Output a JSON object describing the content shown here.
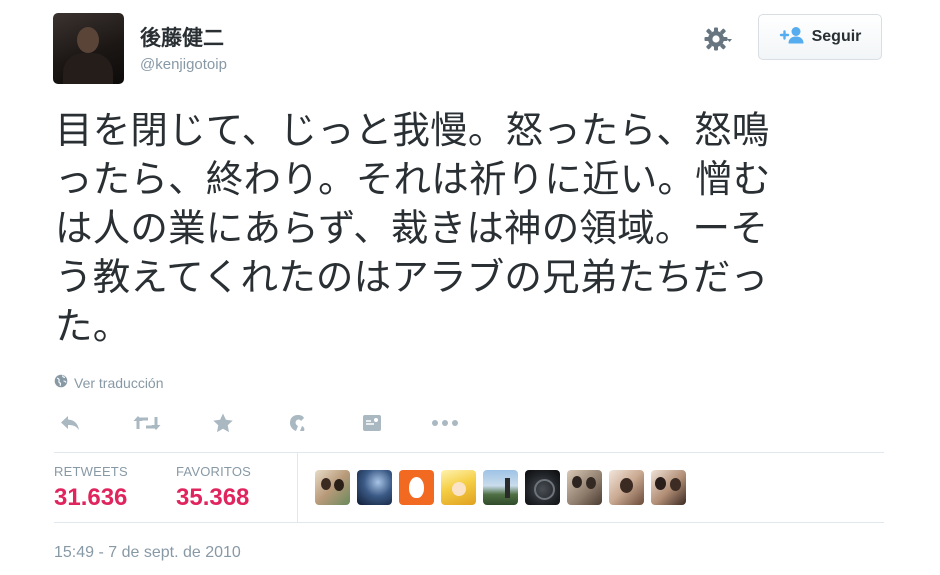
{
  "user": {
    "name": "後藤健二",
    "handle": "@kenjigotoip"
  },
  "follow_button": {
    "label": "Seguir"
  },
  "tweet": {
    "text": "目を閉じて、じっと我慢。怒ったら、怒鳴\nったら、終わり。それは祈りに近い。憎む\nは人の業にあらず、裁きは神の領域。ーそ\nう教えてくれたのはアラブの兄弟たちだっ\nた。",
    "translate_label": "Ver traducción",
    "timestamp": "15:49 - 7 de sept. de 2010"
  },
  "stats": {
    "retweets_label": "RETWEETS",
    "retweets_value": "31.636",
    "favorites_label": "FAVORITOS",
    "favorites_value": "35.368"
  },
  "icons": {
    "settings": "gear-icon",
    "follow": "add-user-icon",
    "translate": "globe-icon",
    "actions": [
      "reply-icon",
      "retweet-icon",
      "favorite-icon",
      "vine-icon",
      "photo-icon",
      "more-icon"
    ]
  },
  "colors": {
    "accent": "#55acee",
    "count": "#e0245e",
    "muted": "#8899a6",
    "text": "#292f33"
  },
  "favoriters": [
    {
      "avatar": "user-avatar-1"
    },
    {
      "avatar": "user-avatar-2"
    },
    {
      "avatar": "user-avatar-3"
    },
    {
      "avatar": "user-avatar-4"
    },
    {
      "avatar": "user-avatar-5"
    },
    {
      "avatar": "user-avatar-6"
    },
    {
      "avatar": "user-avatar-7"
    },
    {
      "avatar": "user-avatar-8"
    },
    {
      "avatar": "user-avatar-9"
    }
  ]
}
